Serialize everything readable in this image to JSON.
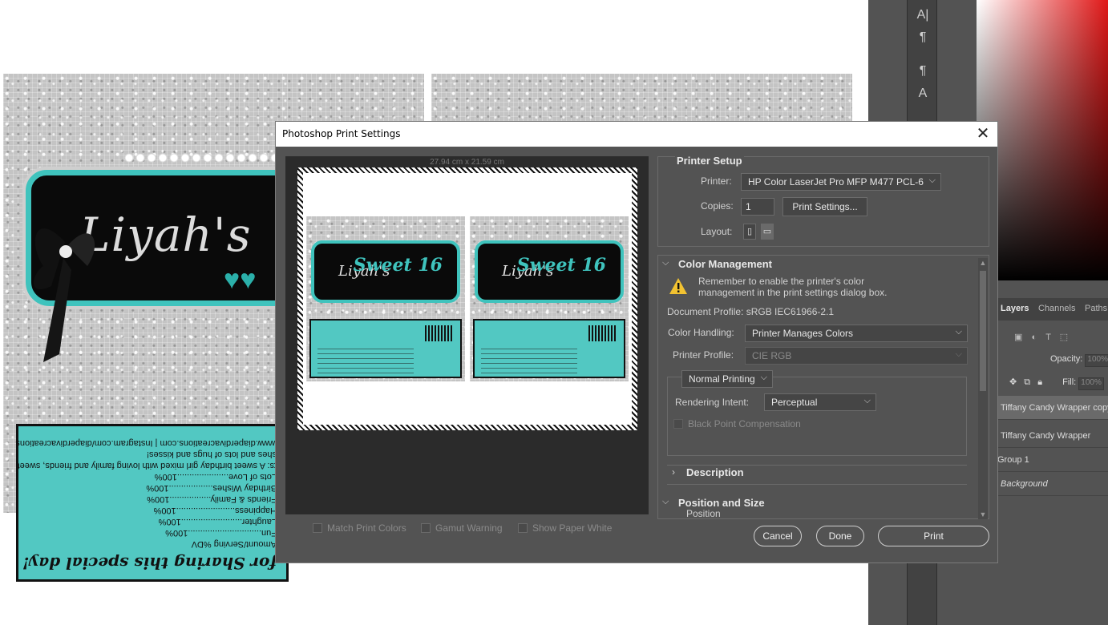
{
  "canvas": {
    "left_name": "Liyah's",
    "sweet_text": "Sweet 16",
    "nutrition_lines": [
      "for Sharing this special day!",
      "Amount/Serving      %DV",
      "Fun..............................100%",
      "Laughter.........................100%",
      "Happiness........................100%",
      "Friends & Family.................100%",
      "Birthday Wishes..................100%",
      "Lots of Love.....................100%",
      "ts: A sweet birthday girl mixed with loving family and friends, sweet",
      "shes and lots of hugs and kisses!",
      "www.diaperdivacreations.com | Instagram.com/diaperdivacreations"
    ]
  },
  "ps_panels": {
    "tabs": [
      "Layers",
      "Channels",
      "Paths"
    ],
    "opacity_label": "Opacity:",
    "opacity_value": "100%",
    "fill_label": "Fill:",
    "fill_value": "100%",
    "layers": [
      "Tiffany Candy Wrapper copy",
      "Tiffany Candy Wrapper",
      "Group 1",
      "Background"
    ]
  },
  "dialog": {
    "title": "Photoshop Print Settings",
    "close_label": "✕",
    "paper_size": "27.94 cm x 21.59 cm",
    "preview_name": "Liyah's",
    "preview_sweet": "Sweet 16",
    "checkboxes": [
      "Match Print Colors",
      "Gamut Warning",
      "Show Paper White"
    ],
    "printer_setup": {
      "heading": "Printer Setup",
      "printer_label": "Printer:",
      "printer_value": "HP Color LaserJet Pro MFP M477 PCL-6",
      "copies_label": "Copies:",
      "copies_value": "1",
      "print_settings_button": "Print Settings...",
      "layout_label": "Layout:"
    },
    "color_management": {
      "heading": "Color Management",
      "warning": "Remember to enable the printer's color management in the print settings dialog box.",
      "document_profile": "Document Profile: sRGB IEC61966-2.1",
      "color_handling_label": "Color Handling:",
      "color_handling_value": "Printer Manages Colors",
      "printer_profile_label": "Printer Profile:",
      "printer_profile_value": "CIE RGB",
      "printing_mode": "Normal Printing",
      "rendering_intent_label": "Rendering Intent:",
      "rendering_intent_value": "Perceptual",
      "black_point_label": "Black Point Compensation"
    },
    "description_heading": "Description",
    "position_heading": "Position and Size",
    "position_sub": "Position",
    "buttons": {
      "cancel": "Cancel",
      "done": "Done",
      "print": "Print"
    }
  }
}
